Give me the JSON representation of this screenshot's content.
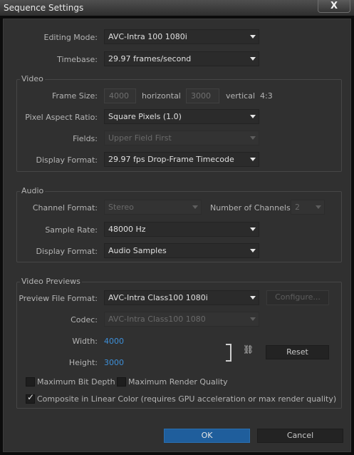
{
  "window": {
    "title": "Sequence Settings",
    "close_symbol": "X"
  },
  "general": {
    "editing_mode_label": "Editing Mode:",
    "editing_mode_value": "AVC-Intra 100 1080i",
    "timebase_label": "Timebase:",
    "timebase_value": "29.97 frames/second"
  },
  "video": {
    "section_title": "Video",
    "frame_size_label": "Frame Size:",
    "frame_width": "4000",
    "horizontal_label": "horizontal",
    "frame_height": "3000",
    "vertical_label": "vertical",
    "aspect_ratio": "4:3",
    "pixel_aspect_label": "Pixel Aspect Ratio:",
    "pixel_aspect_value": "Square Pixels (1.0)",
    "fields_label": "Fields:",
    "fields_value": "Upper Field First",
    "display_format_label": "Display Format:",
    "display_format_value": "29.97 fps Drop-Frame Timecode"
  },
  "audio": {
    "section_title": "Audio",
    "channel_format_label": "Channel Format:",
    "channel_format_value": "Stereo",
    "num_channels_label": "Number of Channels:",
    "num_channels_value": "2",
    "sample_rate_label": "Sample Rate:",
    "sample_rate_value": "48000 Hz",
    "display_format_label": "Display Format:",
    "display_format_value": "Audio Samples"
  },
  "previews": {
    "section_title": "Video Previews",
    "preview_format_label": "Preview File Format:",
    "preview_format_value": "AVC-Intra Class100 1080i",
    "configure_label": "Configure...",
    "codec_label": "Codec:",
    "codec_value": "AVC-Intra Class100 1080",
    "width_label": "Width:",
    "width_value": "4000",
    "height_label": "Height:",
    "height_value": "3000",
    "reset_label": "Reset",
    "max_bit_depth_label": "Maximum Bit Depth",
    "max_render_quality_label": "Maximum Render Quality",
    "composite_linear_label": "Composite in Linear Color (requires GPU acceleration or max render quality)",
    "max_bit_depth_checked": false,
    "max_render_quality_checked": false,
    "composite_linear_checked": true
  },
  "footer": {
    "ok_label": "OK",
    "cancel_label": "Cancel"
  },
  "colors": {
    "accent": "#1f5e9c",
    "link_value": "#3d8fd8",
    "background": "#303030"
  }
}
